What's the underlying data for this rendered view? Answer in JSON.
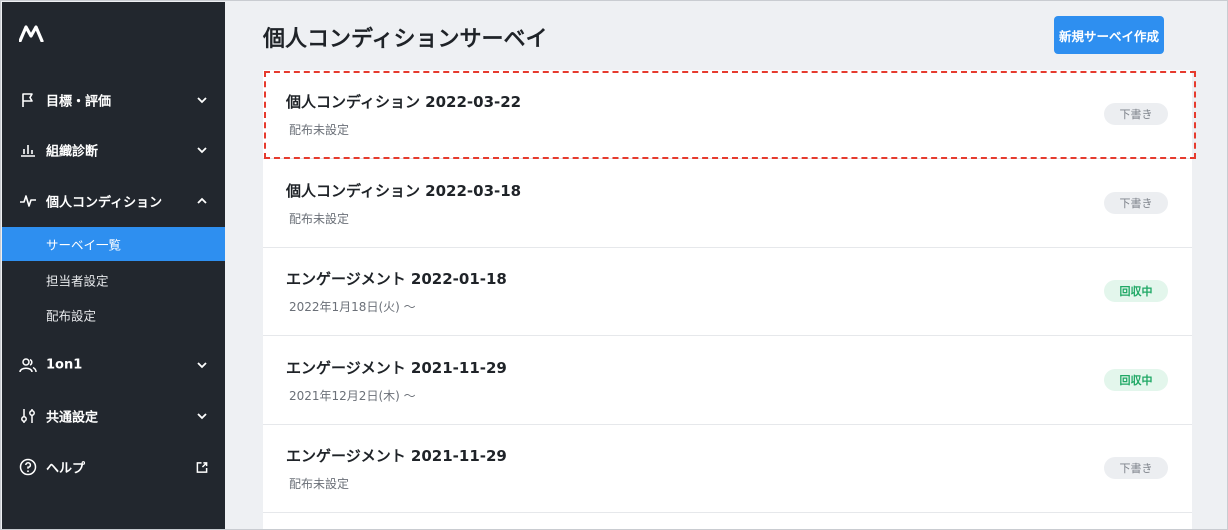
{
  "sidebar": {
    "logo_icon": "brand-logo-icon",
    "items": [
      {
        "label": "目標・評価",
        "icon": "flag-icon",
        "expanded": false
      },
      {
        "label": "組織診断",
        "icon": "bar-chart-icon",
        "expanded": false
      },
      {
        "label": "個人コンディション",
        "icon": "pulse-icon",
        "expanded": true
      },
      {
        "label": "1on1",
        "icon": "users-icon",
        "expanded": false
      },
      {
        "label": "共通設定",
        "icon": "sliders-icon",
        "expanded": false
      },
      {
        "label": "ヘルプ",
        "icon": "help-circle-icon",
        "external": true
      }
    ],
    "sub_items": [
      {
        "label": "サーベイ一覧",
        "active": true
      },
      {
        "label": "担当者設定",
        "active": false
      },
      {
        "label": "配布設定",
        "active": false
      }
    ]
  },
  "header": {
    "title": "個人コンディションサーベイ",
    "new_button_label": "新規サーベイ作成"
  },
  "surveys": [
    {
      "title": "個人コンディション 2022-03-22",
      "subtitle": "配布未設定",
      "status": "下書き",
      "status_type": "draft"
    },
    {
      "title": "個人コンディション 2022-03-18",
      "subtitle": "配布未設定",
      "status": "下書き",
      "status_type": "draft"
    },
    {
      "title": "エンゲージメント 2022-01-18",
      "subtitle": "2022年1月18日(火) 〜",
      "status": "回収中",
      "status_type": "collect"
    },
    {
      "title": "エンゲージメント 2021-11-29",
      "subtitle": "2021年12月2日(木) 〜",
      "status": "回収中",
      "status_type": "collect"
    },
    {
      "title": "エンゲージメント 2021-11-29",
      "subtitle": "配布未設定",
      "status": "下書き",
      "status_type": "draft"
    }
  ],
  "colors": {
    "sidebar_bg": "#22272e",
    "accent": "#2e8ff0",
    "highlight": "#e63b2e",
    "collect_badge": "#1fa865"
  }
}
